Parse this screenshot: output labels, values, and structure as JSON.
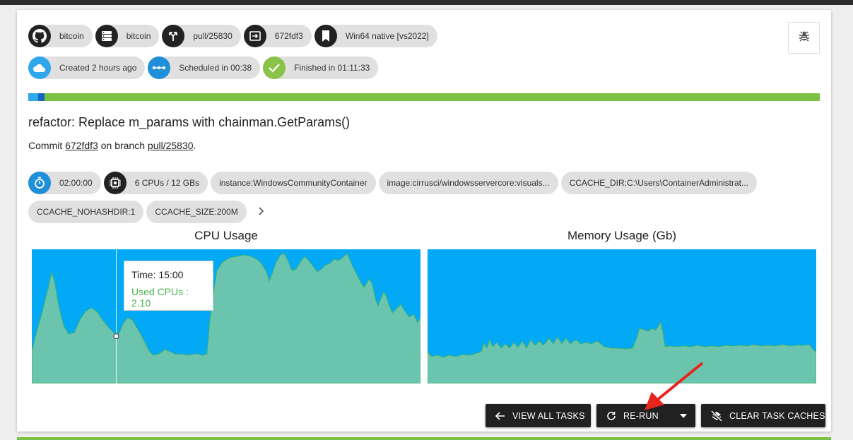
{
  "header_chips": [
    {
      "icon": "github-icon",
      "label": "bitcoin"
    },
    {
      "icon": "repository-icon",
      "label": "bitcoin"
    },
    {
      "icon": "branch-icon",
      "label": "pull/25830"
    },
    {
      "icon": "commit-icon",
      "label": "672fdf3"
    },
    {
      "icon": "bookmark-icon",
      "label": "Win64 native [vs2022]"
    }
  ],
  "status_chips": [
    {
      "icon": "cloud-icon",
      "label": "Created 2 hours ago"
    },
    {
      "icon": "scheduled-icon",
      "label": "Scheduled in 00:38"
    },
    {
      "icon": "check-icon",
      "label": "Finished in 01:11:33"
    }
  ],
  "task": {
    "title": "refactor: Replace m_params with chainman.GetParams()",
    "commit_prefix": "Commit",
    "commit_hash": "672fdf3",
    "commit_middle": "on branch",
    "branch": "pull/25830",
    "commit_suffix": "."
  },
  "resource_chips": {
    "timeout": "02:00:00",
    "cpu_mem": "6 CPUs / 12 GBs",
    "instance": "instance:WindowsCommunityContainer",
    "image": "image:cirrusci/windowsservercore:visuals...",
    "ccache_dir": "CCACHE_DIR:C:\\Users\\ContainerAdministrat...",
    "ccache_nohashdir": "CCACHE_NOHASHDIR:1",
    "ccache_size": "CCACHE_SIZE:200M"
  },
  "charts": {
    "cpu_title": "CPU Usage",
    "mem_title": "Memory Usage (Gb)",
    "tooltip_time": "Time: 15:00",
    "tooltip_value": "Used CPUs : 2.10"
  },
  "buttons": {
    "view_all": "VIEW ALL TASKS",
    "rerun": "RE-RUN",
    "clear_caches": "CLEAR TASK CACHES"
  },
  "colors": {
    "accent_green": "#7bc144",
    "accent_blue": "#2ea7ec",
    "chart_bg": "#03a9f4",
    "chart_fill": "#6bc5ae"
  }
}
